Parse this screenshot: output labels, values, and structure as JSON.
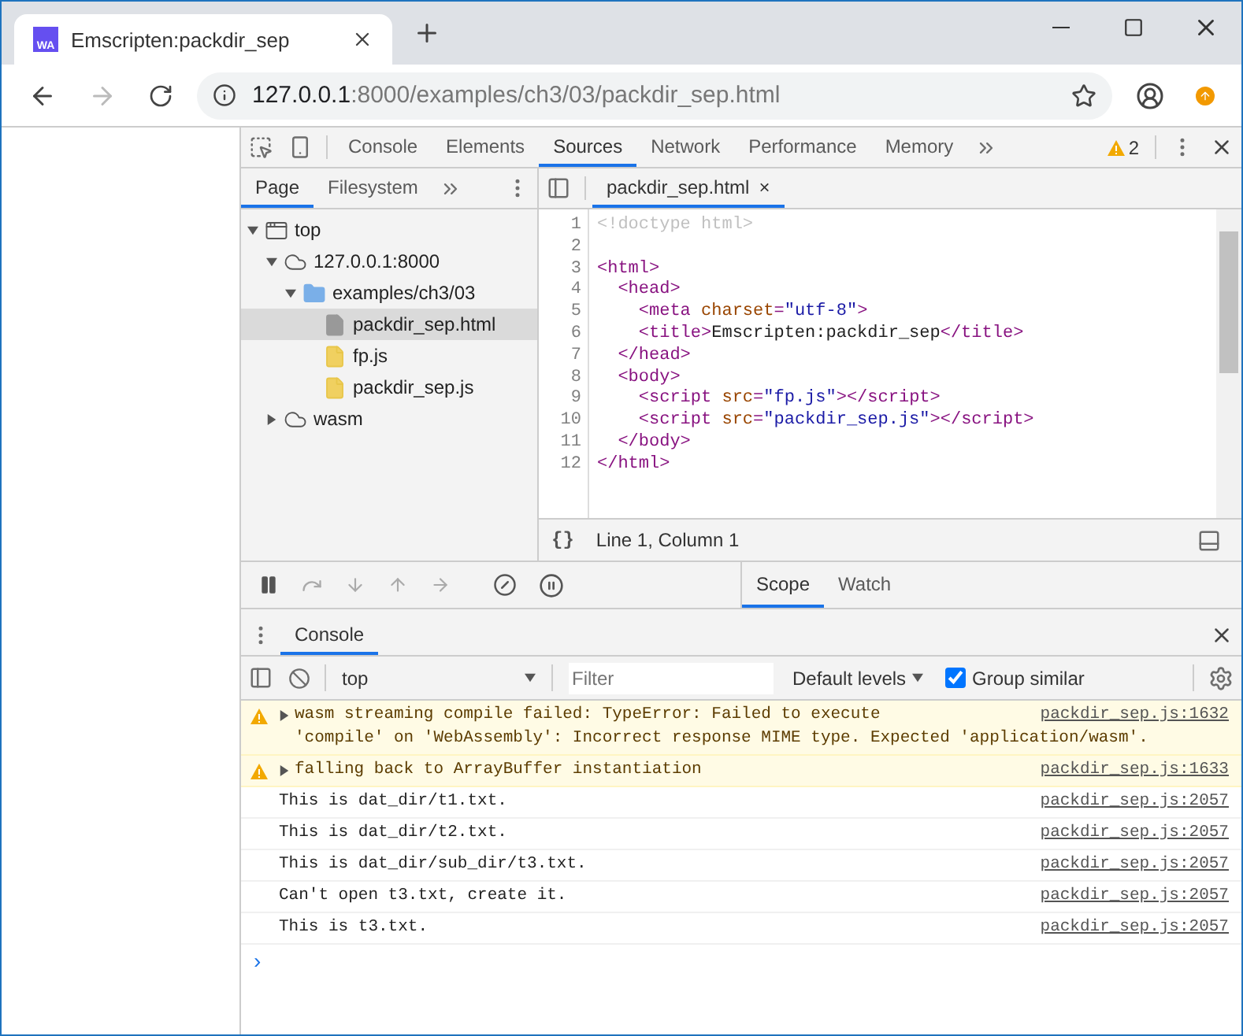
{
  "browser_tab": {
    "title": "Emscripten:packdir_sep",
    "icon_text": "WA"
  },
  "address_bar": {
    "host": "127.0.0.1",
    "rest": ":8000/examples/ch3/03/packdir_sep.html"
  },
  "devtools": {
    "tabs": [
      {
        "label": "Console",
        "selected": false
      },
      {
        "label": "Elements",
        "selected": false
      },
      {
        "label": "Sources",
        "selected": true
      },
      {
        "label": "Network",
        "selected": false
      },
      {
        "label": "Performance",
        "selected": false
      },
      {
        "label": "Memory",
        "selected": false
      }
    ],
    "warning_count": "2",
    "navigator_tabs": [
      {
        "label": "Page",
        "selected": true
      },
      {
        "label": "Filesystem",
        "selected": false
      }
    ],
    "tree": [
      {
        "label": "top",
        "kind": "frame",
        "expanded": true,
        "selected": false,
        "children": [
          {
            "label": "127.0.0.1:8000",
            "kind": "cloud",
            "expanded": true,
            "selected": false,
            "children": [
              {
                "label": "examples/ch3/03",
                "kind": "folder",
                "expanded": true,
                "selected": false,
                "children": [
                  {
                    "label": "packdir_sep.html",
                    "kind": "html",
                    "selected": true
                  },
                  {
                    "label": "fp.js",
                    "kind": "js",
                    "selected": false
                  },
                  {
                    "label": "packdir_sep.js",
                    "kind": "js",
                    "selected": false
                  }
                ]
              }
            ]
          },
          {
            "label": "wasm",
            "kind": "cloud",
            "expanded": false,
            "selected": false
          }
        ]
      }
    ],
    "editor_tab": {
      "label": "packdir_sep.html",
      "close": "×"
    },
    "code": [
      {
        "number": "1",
        "tokens": [
          {
            "kind": "comment",
            "text": "<!doctype html>"
          }
        ]
      },
      {
        "number": "2"
      },
      {
        "number": "3",
        "tokens": [
          {
            "kind": "tag",
            "text": "<html>"
          }
        ]
      },
      {
        "number": "4",
        "tokens": [
          {
            "kind": "tag",
            "text": "  <head>"
          }
        ]
      },
      {
        "number": "5",
        "tokens": [
          {
            "kind": "tag",
            "text": "    <meta "
          },
          {
            "kind": "attr",
            "text": "charset"
          },
          {
            "kind": "tag",
            "text": "="
          },
          {
            "kind": "value",
            "text": "\"utf-8\""
          },
          {
            "kind": "tag",
            "text": ">"
          }
        ]
      },
      {
        "number": "6",
        "tokens": [
          {
            "kind": "tag",
            "text": "    <title>"
          },
          {
            "kind": "text",
            "text": "Emscripten:packdir_sep"
          },
          {
            "kind": "tag",
            "text": "</title>"
          }
        ]
      },
      {
        "number": "7",
        "tokens": [
          {
            "kind": "tag",
            "text": "  </head>"
          }
        ]
      },
      {
        "number": "8",
        "tokens": [
          {
            "kind": "tag",
            "text": "  <body>"
          }
        ]
      },
      {
        "number": "9",
        "tokens": [
          {
            "kind": "tag",
            "text": "    <script "
          },
          {
            "kind": "attr",
            "text": "src"
          },
          {
            "kind": "tag",
            "text": "="
          },
          {
            "kind": "value",
            "text": "\"fp.js\""
          },
          {
            "kind": "tag",
            "text": "></script>"
          }
        ]
      },
      {
        "number": "10",
        "tokens": [
          {
            "kind": "tag",
            "text": "    <script "
          },
          {
            "kind": "attr",
            "text": "src"
          },
          {
            "kind": "tag",
            "text": "="
          },
          {
            "kind": "value",
            "text": "\"packdir_sep.js\""
          },
          {
            "kind": "tag",
            "text": "></script>"
          }
        ]
      },
      {
        "number": "11",
        "tokens": [
          {
            "kind": "tag",
            "text": "  </body>"
          }
        ]
      },
      {
        "number": "12",
        "tokens": [
          {
            "kind": "tag",
            "text": "</html>"
          }
        ]
      }
    ],
    "status": {
      "format": "{}",
      "position": "Line 1, Column 1"
    },
    "sidebar_tabs": [
      {
        "label": "Scope",
        "selected": true
      },
      {
        "label": "Watch",
        "selected": false
      }
    ],
    "drawer_tabs": [
      {
        "label": "Console",
        "selected": true
      }
    ],
    "console_toolbar": {
      "context": "top",
      "filter_placeholder": "Filter",
      "levels": "Default levels",
      "group_similar": {
        "label": "Group similar",
        "checked": true
      }
    },
    "messages": [
      {
        "kind": "warning",
        "lines": [
          "wasm streaming compile failed: TypeError: Failed to execute",
          "'compile' on 'WebAssembly': Incorrect response MIME type. Expected 'application/wasm'."
        ],
        "source": "packdir_sep.js:1632"
      },
      {
        "kind": "warning",
        "lines": [
          "falling back to ArrayBuffer instantiation"
        ],
        "source": "packdir_sep.js:1633"
      },
      {
        "kind": "log",
        "lines": [
          "This is dat_dir/t1.txt."
        ],
        "source": "packdir_sep.js:2057"
      },
      {
        "kind": "log",
        "lines": [
          "This is dat_dir/t2.txt."
        ],
        "source": "packdir_sep.js:2057"
      },
      {
        "kind": "log",
        "lines": [
          "This is dat_dir/sub_dir/t3.txt."
        ],
        "source": "packdir_sep.js:2057"
      },
      {
        "kind": "log",
        "lines": [
          "Can't open t3.txt, create it."
        ],
        "source": "packdir_sep.js:2057"
      },
      {
        "kind": "log",
        "lines": [
          "This is t3.txt."
        ],
        "source": "packdir_sep.js:2057"
      }
    ],
    "prompt": "›"
  }
}
